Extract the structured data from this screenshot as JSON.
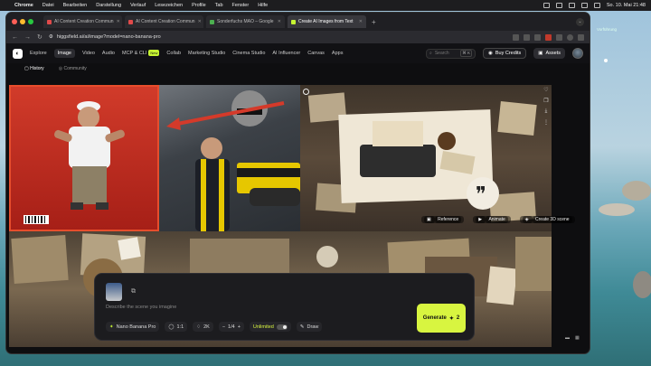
{
  "menubar": {
    "apple": "",
    "items": [
      "Chrome",
      "Datei",
      "Bearbeiten",
      "Darstellung",
      "Verlauf",
      "Lesezeichen",
      "Profile",
      "Tab",
      "Fenster",
      "Hilfe"
    ],
    "datetime": "So. 10. Mai 21:48"
  },
  "desktop": {
    "label": "Vorführung"
  },
  "tabs": [
    {
      "title": "AI Content Creation Commun",
      "color": "#e14a4a",
      "active": false
    },
    {
      "title": "AI Content Creation Commun",
      "color": "#e14a4a",
      "active": false
    },
    {
      "title": "Sonderfuchs MAO – Google",
      "color": "#4caf50",
      "active": false
    },
    {
      "title": "Create AI Images from Text",
      "color": "#c6f432",
      "active": true
    }
  ],
  "address": {
    "url": "higgsfield.ai/ai/image?model=nano-banana-pro"
  },
  "nav": {
    "items": [
      "Explore",
      "Image",
      "Video",
      "Audio",
      "MCP & CLI",
      "Collab",
      "Marketing Studio",
      "Cinema Studio",
      "AI Influencer",
      "Canvas",
      "Apps"
    ],
    "new_badge": "New",
    "search_placeholder": "Search",
    "search_kbd": "⌘ K",
    "buy_credits": "Buy Credits",
    "assets": "Assets"
  },
  "subnav": {
    "history": "History",
    "community": "Community"
  },
  "image_actions": {
    "reference": "Reference",
    "animate": "Animate",
    "create3d": "Create 3D scene"
  },
  "composer": {
    "prompt_placeholder": "Describe the scene you imagine",
    "model": "Nano Banana Pro",
    "ratio": "1:1",
    "resolution": "2K",
    "count": "1/4",
    "unlimited": "Unlimited",
    "draw": "Draw",
    "generate": "Generate",
    "cost": "2"
  },
  "colors": {
    "accent": "#d8f540",
    "selection": "#e74d2c"
  }
}
